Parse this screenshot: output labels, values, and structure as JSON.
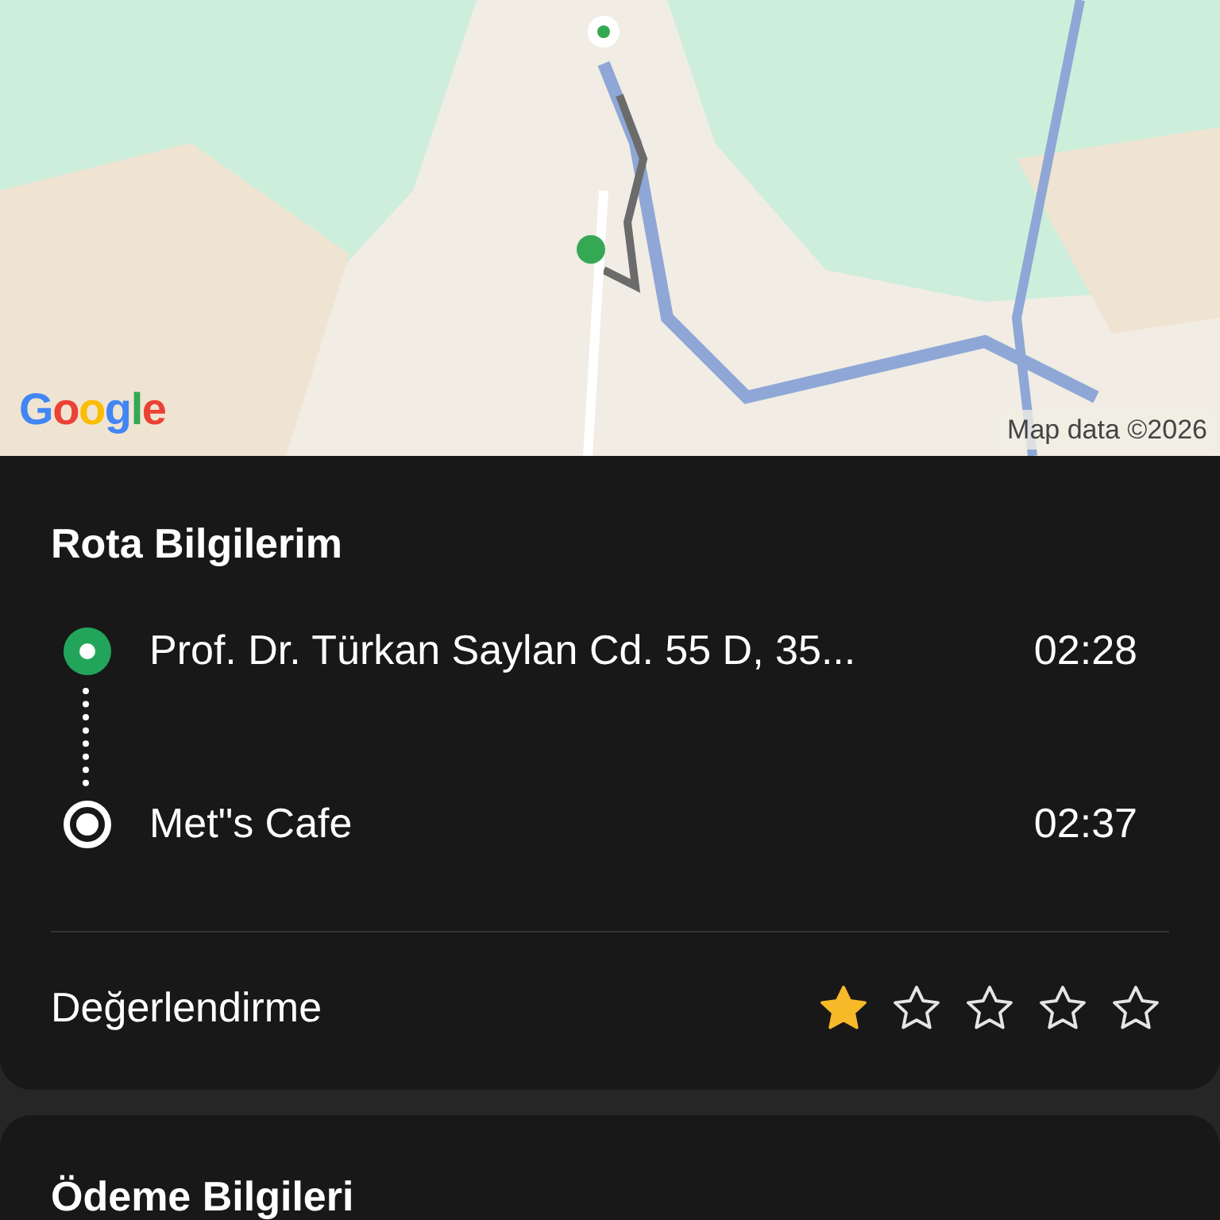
{
  "map": {
    "kind": "picture",
    "logo": "Google",
    "attribution": "Map data ©2026"
  },
  "route": {
    "title": "Rota Bilgilerim",
    "stops": [
      {
        "kind": "origin",
        "name": "Prof. Dr. Türkan Saylan Cd. 55 D, 35...",
        "time": "02:28"
      },
      {
        "kind": "destination",
        "name": "Met\"s Cafe",
        "time": "02:37"
      }
    ],
    "rating": {
      "label": "Değerlendirme",
      "stars": 1
    }
  },
  "payment": {
    "title": "Ödeme Bilgileri"
  }
}
